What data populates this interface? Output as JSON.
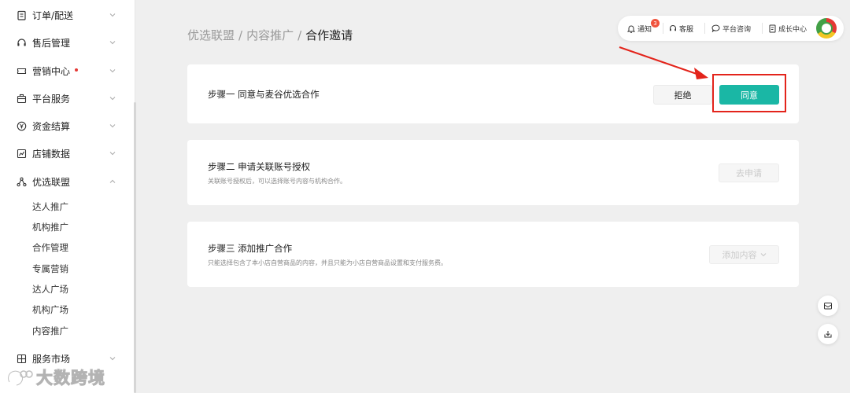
{
  "sidebar": {
    "items": [
      {
        "label": "订单/配送",
        "icon": "clipboard-icon",
        "expanded": false
      },
      {
        "label": "售后管理",
        "icon": "headset-icon",
        "expanded": false
      },
      {
        "label": "营销中心",
        "icon": "ticket-icon",
        "expanded": false,
        "dot": true
      },
      {
        "label": "平台服务",
        "icon": "briefcase-icon",
        "expanded": false
      },
      {
        "label": "资金结算",
        "icon": "yen-icon",
        "expanded": false
      },
      {
        "label": "店铺数据",
        "icon": "chart-icon",
        "expanded": false
      },
      {
        "label": "优选联盟",
        "icon": "network-icon",
        "expanded": true
      },
      {
        "label": "服务市场",
        "icon": "grid-icon",
        "expanded": false
      }
    ],
    "sub_items": [
      "达人推广",
      "机构推广",
      "合作管理",
      "专属营销",
      "达人广场",
      "机构广场",
      "内容推广"
    ]
  },
  "watermark": {
    "text": "大数跨境"
  },
  "breadcrumb": {
    "level1": "优选联盟",
    "level2": "内容推广",
    "current": "合作邀请",
    "separator": "/"
  },
  "toolbar": {
    "notify": "通知",
    "notify_count": "3",
    "service": "客服",
    "consult": "平台咨询",
    "growth": "成长中心"
  },
  "steps": [
    {
      "title": "步骤一 同意与麦谷优选合作",
      "desc": "",
      "reject_label": "拒绝",
      "agree_label": "同意"
    },
    {
      "title": "步骤二 申请关联账号授权",
      "desc": "关联账号授权后，可以选择账号内容与机构合作。",
      "action_label": "去申请"
    },
    {
      "title": "步骤三 添加推广合作",
      "desc": "只能选择包含了本小店自营商品的内容，并且只能为小店自营商品设置和支付服务费。",
      "action_label": "添加内容"
    }
  ],
  "colors": {
    "primary": "#1ab7a5",
    "highlight": "#e3241b",
    "badge": "#f0533d"
  }
}
